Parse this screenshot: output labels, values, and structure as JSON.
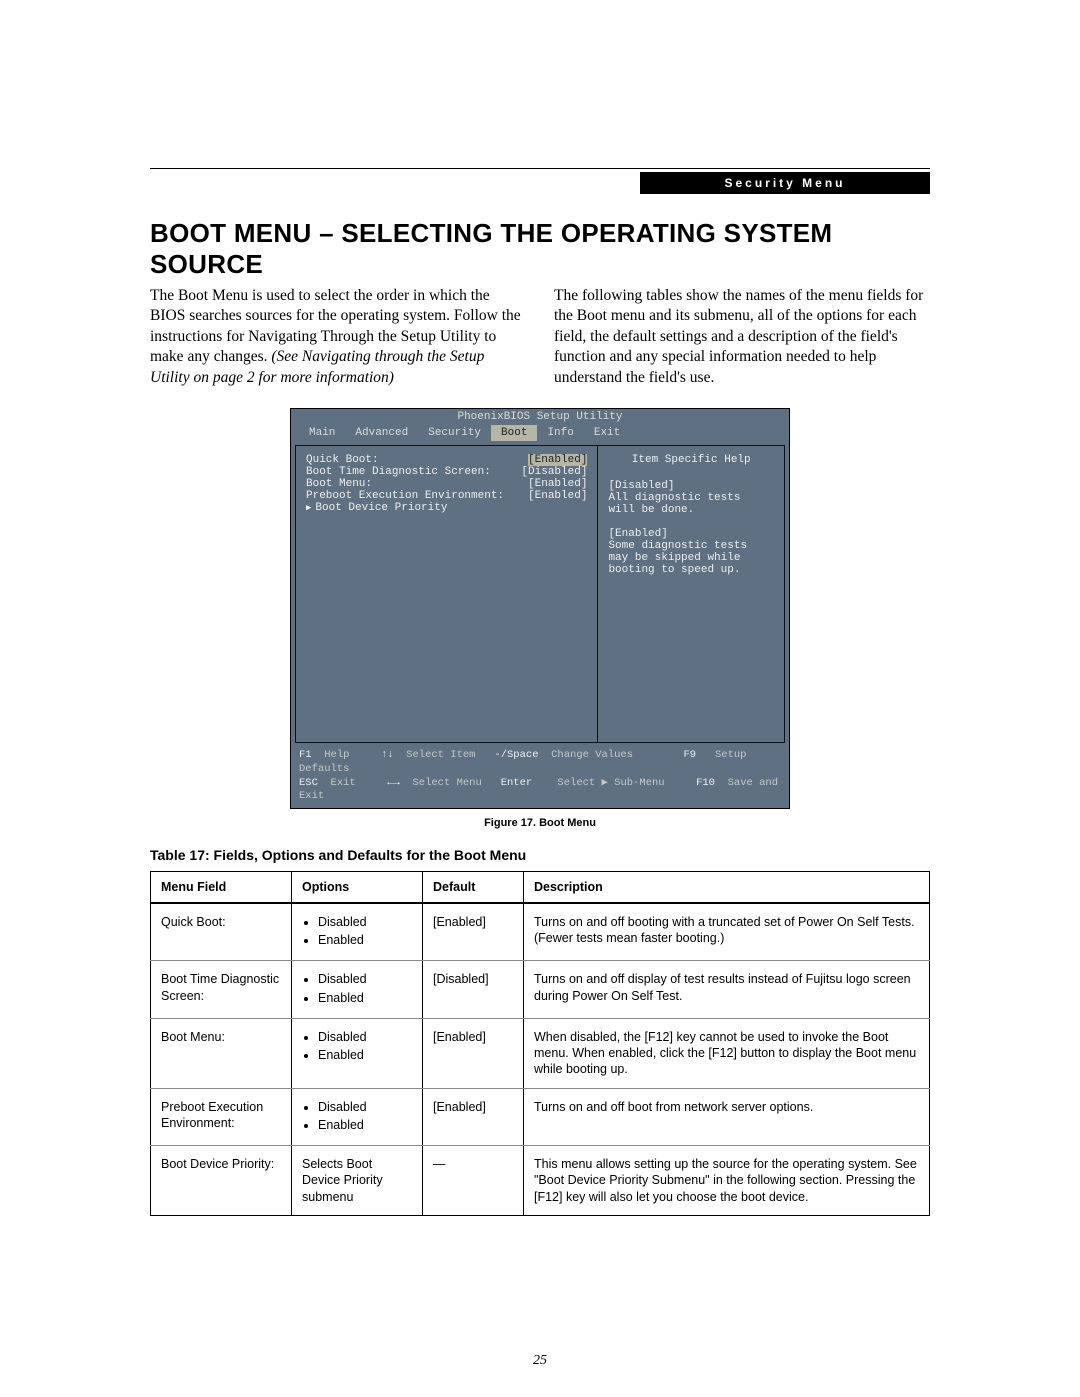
{
  "header": {
    "badge": "Security Menu",
    "title": "Boot Menu – Selecting the Operating System Source"
  },
  "intro": {
    "left_plain": "The Boot Menu is used to select the order in which the BIOS searches sources for the operating system. Follow the instructions for Navigating Through the Setup Utility to make any changes. ",
    "left_italic": "(See Navigating through the Setup Utility on page 2 for more information)",
    "right": "The following tables show the names of the menu fields for the Boot menu and its submenu, all of the options for each field, the default settings and a description of the field's function and any special information needed to help understand the field's use."
  },
  "bios": {
    "title": "PhoenixBIOS Setup Utility",
    "tabs": [
      "Main",
      "Advanced",
      "Security",
      "Boot",
      "Info",
      "Exit"
    ],
    "active_tab": "Boot",
    "rows": [
      {
        "label": "Quick Boot:",
        "value": "[Enabled]",
        "hl": true
      },
      {
        "label": "Boot Time Diagnostic Screen:",
        "value": "[Disabled]"
      },
      {
        "label": "Boot Menu:",
        "value": "[Enabled]"
      },
      {
        "label": "Preboot Execution Environment:",
        "value": "[Enabled]"
      },
      {
        "label": "Boot Device Priority",
        "value": "",
        "tri": true
      }
    ],
    "help_title": "Item Specific Help",
    "help_body": "[Disabled]\nAll diagnostic tests\nwill be done.\n\n[Enabled]\nSome diagnostic tests\nmay be skipped while\nbooting to speed up.",
    "footer": {
      "l1": {
        "f1": "F1",
        "f1l": "Help",
        "a1": "↑↓",
        "a1l": "Select Item",
        "a2": "-/Space",
        "a2l": "Change Values",
        "f9": "F9",
        "f9l": "Setup Defaults"
      },
      "l2": {
        "esc": "ESC",
        "escl": "Exit",
        "a1": "←→",
        "a1l": "Select Menu",
        "a2": "Enter",
        "a2l": "Select ▶ Sub-Menu",
        "f10": "F10",
        "f10l": "Save and Exit"
      }
    }
  },
  "captions": {
    "figure": "Figure 17.  Boot Menu",
    "table": "Table 17: Fields, Options and Defaults for the Boot Menu"
  },
  "table": {
    "headers": [
      "Menu Field",
      "Options",
      "Default",
      "Description"
    ],
    "rows": [
      {
        "field": "Quick Boot:",
        "options": [
          "Disabled",
          "Enabled"
        ],
        "default": "[Enabled]",
        "desc": "Turns on and off booting with a truncated set of Power On Self Tests. (Fewer tests mean faster booting.)"
      },
      {
        "field": "Boot Time Diagnostic Screen:",
        "options": [
          "Disabled",
          "Enabled"
        ],
        "default": "[Disabled]",
        "desc": "Turns on and off display of test results instead of Fujitsu logo screen during Power On Self Test."
      },
      {
        "field": "Boot Menu:",
        "options": [
          "Disabled",
          "Enabled"
        ],
        "default": "[Enabled]",
        "desc": "When disabled, the [F12] key cannot be used to invoke the Boot menu. When enabled, click the [F12] button to display the Boot menu while booting up."
      },
      {
        "field": "Preboot Execution Environment:",
        "options": [
          "Disabled",
          "Enabled"
        ],
        "default": "[Enabled]",
        "desc": "Turns on and off boot from network server options."
      },
      {
        "field": "Boot Device Priority:",
        "options_text": "Selects Boot Device Priority submenu",
        "default": "—",
        "desc": "This menu allows setting up the source for the operating system. See \"Boot Device Priority Submenu\" in the following section. Pressing the [F12] key will also let you choose the boot device."
      }
    ]
  },
  "page_number": "25"
}
